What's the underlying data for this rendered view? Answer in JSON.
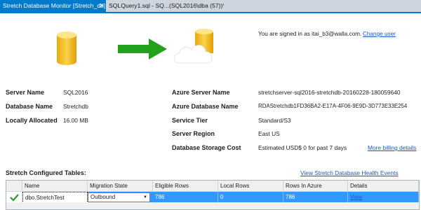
{
  "tabs": [
    {
      "label": "Stretch Database Monitor [Stretch_db]",
      "active": true
    },
    {
      "label": "SQLQuery1.sql - SQ...(SQL2016\\dba (57))*",
      "active": false
    }
  ],
  "tab_close_glyph": "✕",
  "account": {
    "signed_in_text": "You are signed in as itai_b3@walla.com.",
    "change_user_label": "Change user"
  },
  "local": {
    "server_name_label": "Server Name",
    "server_name_value": "SQL2016",
    "database_name_label": "Database Name",
    "database_name_value": "Stretchdb",
    "locally_allocated_label": "Locally Allocated",
    "locally_allocated_value": "16.00 MB"
  },
  "azure": {
    "server_name_label": "Azure Server Name",
    "server_name_value": "stretchserver-sql2016-stretchdb-20160228-180059640",
    "database_name_label": "Azure Database Name",
    "database_name_value": "RDAStretchdb1FD36BA2-E17A-4F06-9E9D-3D773E33E254",
    "service_tier_label": "Service Tier",
    "service_tier_value": "Standard/S3",
    "server_region_label": "Server Region",
    "server_region_value": "East US",
    "storage_cost_label": "Database Storage Cost",
    "storage_cost_value": "Estimated USD$ 0 for past 7 days",
    "more_billing_label": "More billing details"
  },
  "tables_section": {
    "title": "Stretch Configured Tables:",
    "health_link": "View Stretch Database Health Events",
    "columns": [
      "Name",
      "Migration State",
      "Eligible Rows",
      "Local Rows",
      "Rows In Azure",
      "Details"
    ],
    "rows": [
      {
        "checked": true,
        "name": "dbo.StretchTest",
        "migration_state": "Outbound",
        "eligible_rows": "786",
        "local_rows": "0",
        "rows_in_azure": "786",
        "details": "View"
      }
    ]
  },
  "icons": {
    "database": "database-cylinder-icon",
    "arrow": "arrow-right-icon",
    "cloud": "cloud-database-icon",
    "check": "checkmark-icon",
    "dropdown": "chevron-down-icon"
  },
  "colors": {
    "accent": "#007acc",
    "selection": "#3399ff",
    "link": "#1a57c7",
    "arrow": "#22a11c",
    "database": "#f5c518"
  }
}
